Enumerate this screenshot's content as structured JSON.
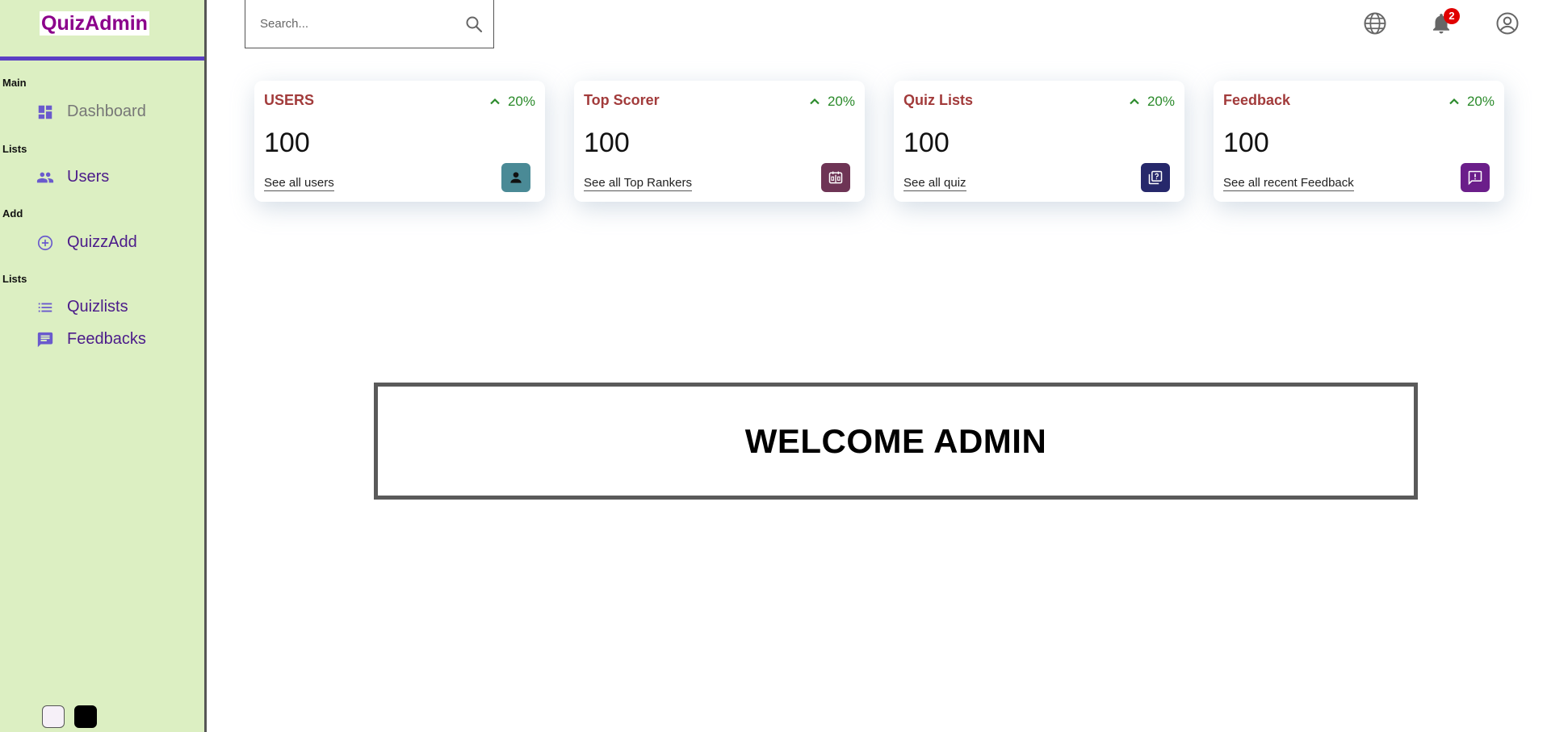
{
  "brand": {
    "title": "QuizAdmin"
  },
  "sidebar": {
    "sections": [
      {
        "title": "Main"
      },
      {
        "title": "Lists"
      },
      {
        "title": "Add"
      },
      {
        "title": "Lists"
      }
    ],
    "items": [
      {
        "label": "Dashboard",
        "icon": "dashboard-icon"
      },
      {
        "label": "Users",
        "icon": "people-icon"
      },
      {
        "label": "QuizzAdd",
        "icon": "add-circle-icon"
      },
      {
        "label": "Quizlists",
        "icon": "list-icon"
      },
      {
        "label": "Feedbacks",
        "icon": "feedback-icon"
      }
    ],
    "theme_options": [
      "light",
      "dark"
    ]
  },
  "topbar": {
    "search_placeholder": "Search...",
    "notification_count": "2"
  },
  "widgets": [
    {
      "title": "USERS",
      "percentage": "20%",
      "count": "100",
      "link": "See all users",
      "icon": "person-icon",
      "icon_color": "#4a8a96"
    },
    {
      "title": "Top Scorer",
      "percentage": "20%",
      "count": "100",
      "link": "See all Top Rankers",
      "icon": "scoreboard-icon",
      "icon_color": "#6e3455"
    },
    {
      "title": "Quiz Lists",
      "percentage": "20%",
      "count": "100",
      "link": "See all quiz",
      "icon": "quiz-icon",
      "icon_color": "#26286b"
    },
    {
      "title": "Feedback",
      "percentage": "20%",
      "count": "100",
      "link": "See all recent Feedback",
      "icon": "feedback-icon",
      "icon_color": "#6b1e8a"
    }
  ],
  "welcome": {
    "text": "WELCOME ADMIN"
  },
  "colors": {
    "sidebar_bg": "#dcefc2",
    "accent": "#5b3fc4",
    "brand_text": "#8b008b",
    "widget_title": "#a23b3b",
    "positive": "#2a8a2a"
  }
}
